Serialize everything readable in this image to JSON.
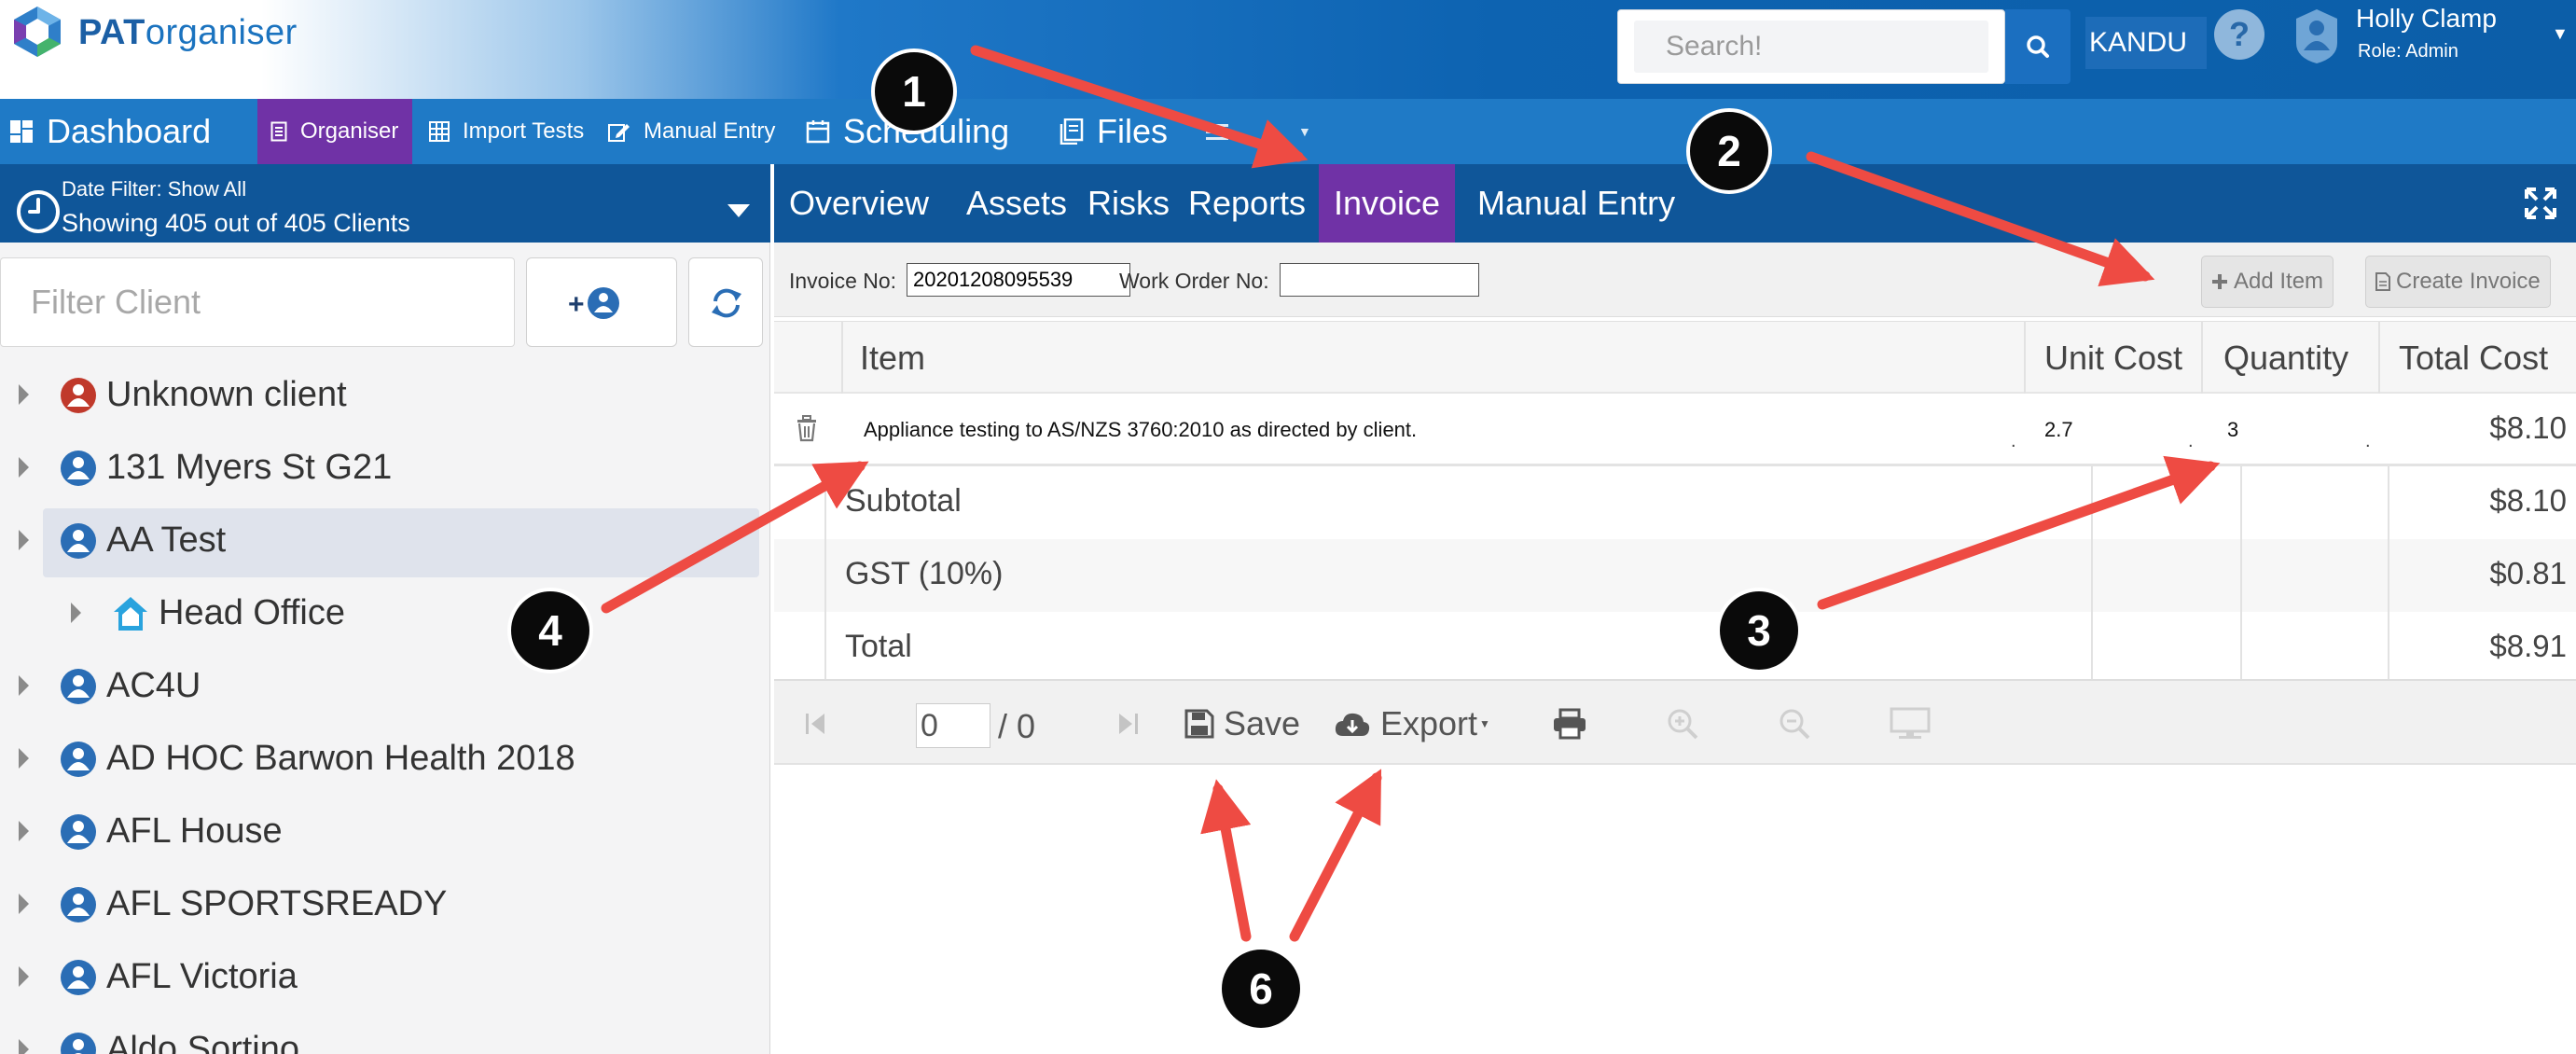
{
  "app": {
    "logo_text_bold": "PAT",
    "logo_text_rest": "organiser",
    "brand_colors": {
      "blue": "#1f7ac6",
      "dark_blue": "#0f5699",
      "purple": "#7032a6"
    }
  },
  "header": {
    "search_placeholder": "Search!",
    "account": "KANDU",
    "user_name": "Holly Clamp",
    "user_role": "Role: Admin"
  },
  "nav": {
    "dashboard": "Dashboard",
    "organiser": "Organiser",
    "import_tests": "Import Tests",
    "manual_entry": "Manual Entry",
    "scheduling": "Scheduling",
    "files": "Files"
  },
  "sidebar": {
    "date_filter_label": "Date Filter:  Show All",
    "showing": "Showing 405 out of 405 Clients",
    "filter_placeholder": "Filter Client",
    "clients": [
      {
        "name": "Unknown client",
        "icon": "client-red-icon"
      },
      {
        "name": "131 Myers St G21",
        "icon": "client-icon"
      },
      {
        "name": "AA Test",
        "icon": "client-icon",
        "selected": true
      },
      {
        "name": "Head Office",
        "icon": "site-icon",
        "child": true
      },
      {
        "name": "AC4U",
        "icon": "client-icon"
      },
      {
        "name": "AD HOC Barwon Health 2018",
        "icon": "client-icon"
      },
      {
        "name": "AFL House",
        "icon": "client-icon"
      },
      {
        "name": "AFL SPORTSREADY",
        "icon": "client-icon"
      },
      {
        "name": "AFL Victoria",
        "icon": "client-icon"
      },
      {
        "name": "Aldo Sortino",
        "icon": "client-icon"
      }
    ]
  },
  "tabs": [
    "Overview",
    "Assets",
    "Risks",
    "Reports",
    "Invoice",
    "Manual Entry"
  ],
  "active_tab": "Invoice",
  "invoice": {
    "invoice_no_label": "Invoice No:",
    "invoice_no": "20201208095539",
    "work_order_label": "Work Order No:",
    "work_order": "",
    "add_item": "Add Item",
    "create_invoice": "Create Invoice",
    "columns": [
      "Item",
      "Unit Cost",
      "Quantity",
      "Total Cost"
    ],
    "items": [
      {
        "item": "Appliance testing to AS/NZS 3760:2010 as directed by client.",
        "unit_cost": "2.7",
        "quantity": "3",
        "total": "$8.10"
      }
    ],
    "subtotal_label": "Subtotal",
    "subtotal": "$8.10",
    "gst_label": "GST (10%)",
    "gst": "$0.81",
    "total_label": "Total",
    "total": "$8.91"
  },
  "pdf_toolbar": {
    "page_value": "0",
    "page_of": "/ 0",
    "save": "Save",
    "export": "Export"
  },
  "annotations": [
    "1",
    "2",
    "3",
    "4",
    "6"
  ]
}
